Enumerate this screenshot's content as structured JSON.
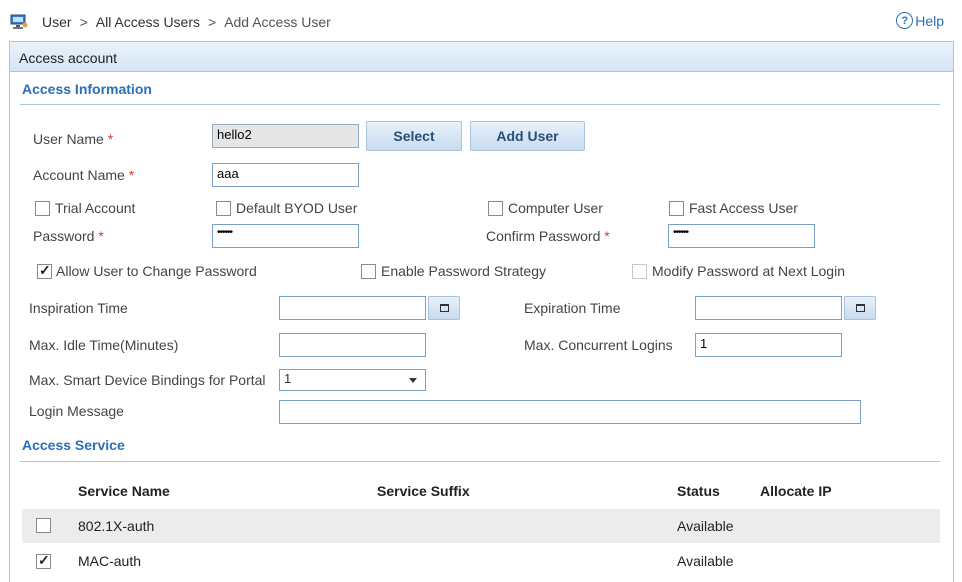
{
  "breadcrumb": {
    "item1": "User",
    "item2": "All Access Users",
    "current": "Add Access User",
    "sep": ">"
  },
  "help_label": "Help",
  "panel_title": "Access account",
  "access_info": {
    "title": "Access Information",
    "user_name_label": "User Name",
    "user_name_value": "hello2",
    "select_button": "Select",
    "add_user_button": "Add User",
    "account_name_label": "Account Name",
    "account_name_value": "aaa",
    "trial_account": "Trial Account",
    "default_byod": "Default BYOD User",
    "computer_user": "Computer User",
    "fast_access_user": "Fast Access User",
    "password_label": "Password",
    "password_value": "••••••",
    "confirm_password_label": "Confirm Password",
    "confirm_password_value": "••••••",
    "allow_change_password": "Allow User to Change Password",
    "enable_password_strategy": "Enable Password Strategy",
    "modify_password_next_login": "Modify Password at Next Login",
    "inspiration_time_label": "Inspiration Time",
    "expiration_time_label": "Expiration Time",
    "max_idle_label": "Max. Idle Time(Minutes)",
    "max_concurrent_label": "Max. Concurrent Logins",
    "max_concurrent_value": "1",
    "max_smart_label": "Max. Smart Device Bindings for Portal",
    "max_smart_value": "1",
    "login_message_label": "Login Message",
    "required_mark": "*"
  },
  "access_service": {
    "title": "Access Service",
    "columns": [
      "Service Name",
      "Service Suffix",
      "Status",
      "Allocate IP"
    ],
    "rows": [
      {
        "name": "802.1X-auth",
        "suffix": "",
        "status": "Available",
        "checked": false
      },
      {
        "name": "MAC-auth",
        "suffix": "",
        "status": "Available",
        "checked": true
      }
    ]
  }
}
